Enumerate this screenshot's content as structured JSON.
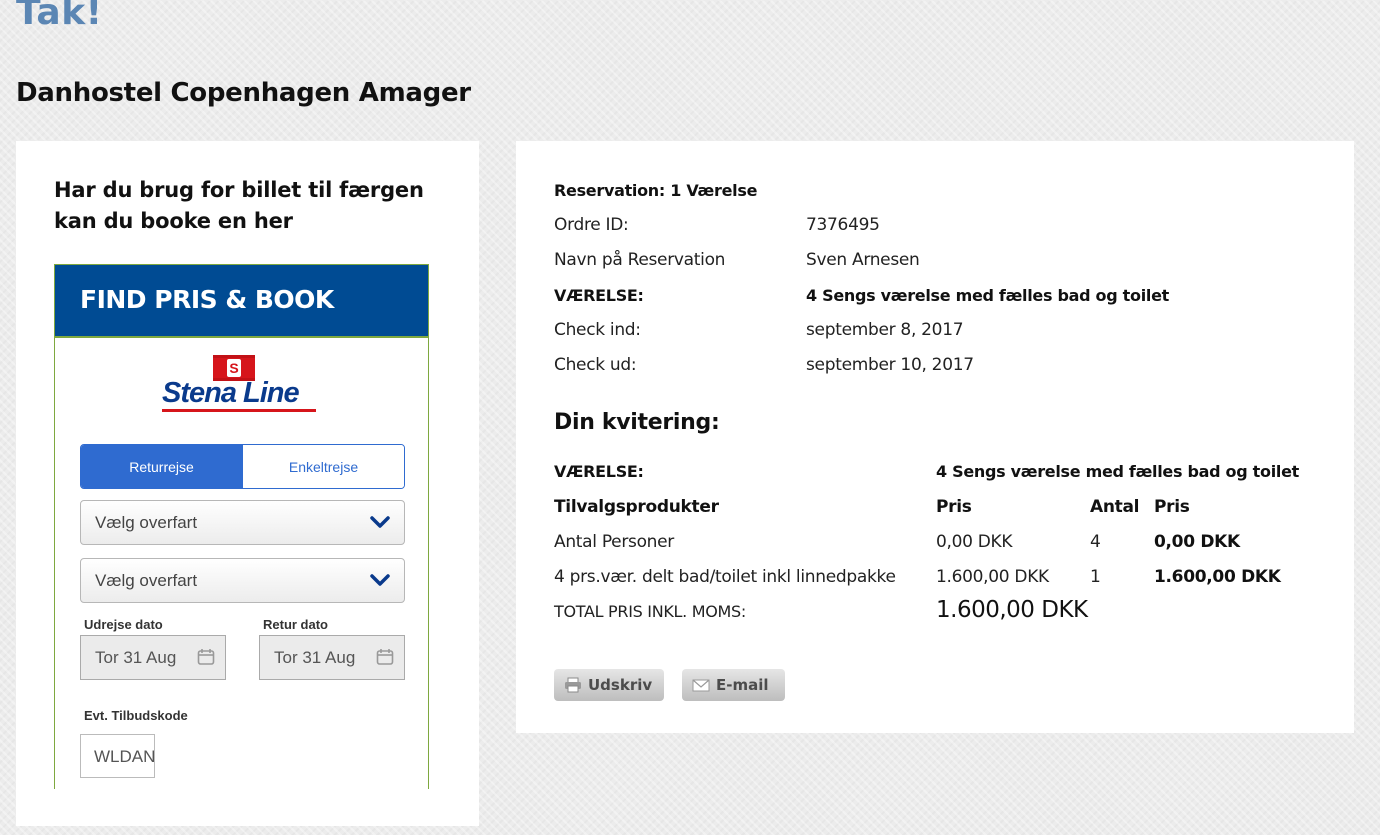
{
  "page": {
    "title": "Tak!",
    "hostel_name": "Danhostel Copenhagen Amager"
  },
  "ferry": {
    "heading": "Har du brug for billet til færgen kan du booke en her",
    "widget_title": "FIND PRIS & BOOK",
    "logo_text": "Stena Line",
    "logo_flag_letter": "S",
    "trip_types": [
      "Returrejse",
      "Enkeltrejse"
    ],
    "selected_trip_type": "Returrejse",
    "route_select_1": "Vælg overfart",
    "route_select_2": "Vælg overfart",
    "departure_label": "Udrejse dato",
    "departure_value": "Tor 31 Aug",
    "return_label": "Retur dato",
    "return_value": "Tor 31 Aug",
    "promo_label": "Evt. Tilbudskode",
    "promo_value": "WLDANHOSTEL",
    "colors": {
      "header": "#004b93",
      "accent_blue": "#2f6bd0",
      "green_border": "#7ea83f",
      "stena_red": "#d6151b"
    }
  },
  "reservation": {
    "title": "Reservation: 1 Værelse",
    "order_id_label": "Ordre ID:",
    "order_id": "7376495",
    "name_label": "Navn på Reservation",
    "name": "Sven Arnesen",
    "room_label": "VÆRELSE:",
    "room": "4 Sengs værelse med fælles bad og toilet",
    "checkin_label": "Check ind:",
    "checkin": "september 8, 2017",
    "checkout_label": "Check ud:",
    "checkout": "september 10, 2017"
  },
  "receipt": {
    "heading": "Din kvitering:",
    "room_label": "VÆRELSE:",
    "room": "4 Sengs værelse med fælles bad og toilet",
    "headers": {
      "product": "Tilvalgsprodukter",
      "price": "Pris",
      "qty": "Antal",
      "total": "Pris"
    },
    "rows": [
      {
        "product": "Antal Personer",
        "price": "0,00 DKK",
        "qty": "4",
        "total": "0,00 DKK"
      },
      {
        "product": "4 prs.vær. delt bad/toilet inkl linnedpakke",
        "price": "1.600,00 DKK",
        "qty": "1",
        "total": "1.600,00 DKK"
      }
    ],
    "total_label": "TOTAL PRIS INKL. MOMS:",
    "total_amount": "1.600,00 DKK"
  },
  "actions": {
    "print_label": "Udskriv",
    "print_icon": "printer-icon",
    "email_label": "E-mail",
    "email_icon": "envelope-icon"
  },
  "colors": {
    "title_blue": "#5b86b4",
    "panel_bg": "#ffffff",
    "page_bg": "#ececec"
  }
}
